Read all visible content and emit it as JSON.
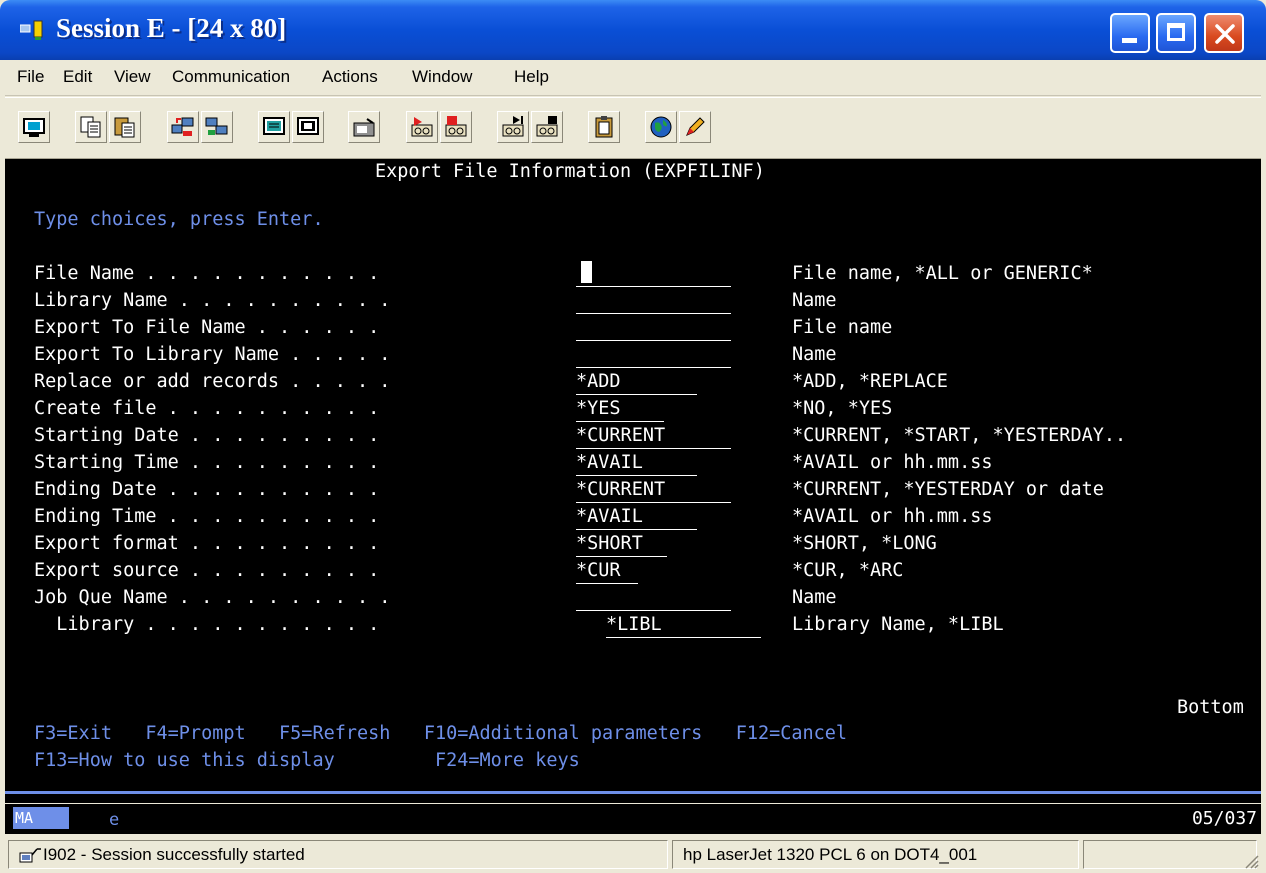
{
  "window": {
    "title": "Session E - [24 x 80]",
    "controls": [
      "minimize",
      "maximize",
      "close"
    ]
  },
  "menu": [
    "File",
    "Edit",
    "View",
    "Communication",
    "Actions",
    "Window",
    "Help"
  ],
  "toolbar": {
    "icons": [
      "print-screen-icon",
      "copy-icon",
      "paste-icon",
      "send-file-icon",
      "receive-file-icon",
      "display-setup-icon",
      "keyboard-map-icon",
      "macro-record-icon",
      "macro-play-icon",
      "macro-stop-icon",
      "run-macro-icon",
      "run-script-icon",
      "clipboard-icon",
      "globe-help-icon",
      "edit-pencil-icon"
    ]
  },
  "screen": {
    "header": "Export File Information (EXPFILINF)",
    "instruction": "Type choices, press Enter.",
    "fields": [
      {
        "label": "File Name . . . . . . . . . . .",
        "value": "",
        "hint": "File name, *ALL or GENERIC*"
      },
      {
        "label": "Library Name . . . . . . . . . .",
        "value": "",
        "hint": "Name"
      },
      {
        "label": "Export To File Name . . . . . .",
        "value": "",
        "hint": "File name"
      },
      {
        "label": "Export To Library Name . . . . .",
        "value": "",
        "hint": "Name"
      },
      {
        "label": "Replace or add records . . . . .",
        "value": "*ADD",
        "hint": "*ADD, *REPLACE"
      },
      {
        "label": "Create file . . . . . . . . . .",
        "value": "*YES",
        "hint": "*NO, *YES"
      },
      {
        "label": "Starting Date . . . . . . . . .",
        "value": "*CURRENT",
        "hint": "*CURRENT, *START, *YESTERDAY.."
      },
      {
        "label": "Starting Time . . . . . . . . .",
        "value": "*AVAIL",
        "hint": "*AVAIL or hh.mm.ss"
      },
      {
        "label": "Ending Date . . . . . . . . . .",
        "value": "*CURRENT",
        "hint": "*CURRENT, *YESTERDAY or date"
      },
      {
        "label": "Ending Time . . . . . . . . . .",
        "value": "*AVAIL",
        "hint": "*AVAIL or hh.mm.ss"
      },
      {
        "label": "Export format . . . . . . . . .",
        "value": "*SHORT",
        "hint": "*SHORT, *LONG"
      },
      {
        "label": "Export source . . . . . . . . .",
        "value": "*CUR",
        "hint": "*CUR, *ARC"
      },
      {
        "label": "Job Que Name . . . . . . . . . .",
        "value": "",
        "hint": "Name"
      },
      {
        "label": "  Library . . . . . . . . . . .",
        "value": "*LIBL",
        "hint": "Library Name, *LIBL"
      }
    ],
    "bottom": "Bottom",
    "function_keys": {
      "row1": "F3=Exit   F4=Prompt   F5=Refresh   F10=Additional parameters   F12=Cancel",
      "row2": "F13=How to use this display         F24=More keys"
    }
  },
  "oia": {
    "mode": "MA",
    "indicator": "e",
    "cursor_position": "05/037"
  },
  "status": {
    "message": "I902 - Session successfully started",
    "printer": "hp LaserJet 1320 PCL 6 on DOT4_001"
  }
}
